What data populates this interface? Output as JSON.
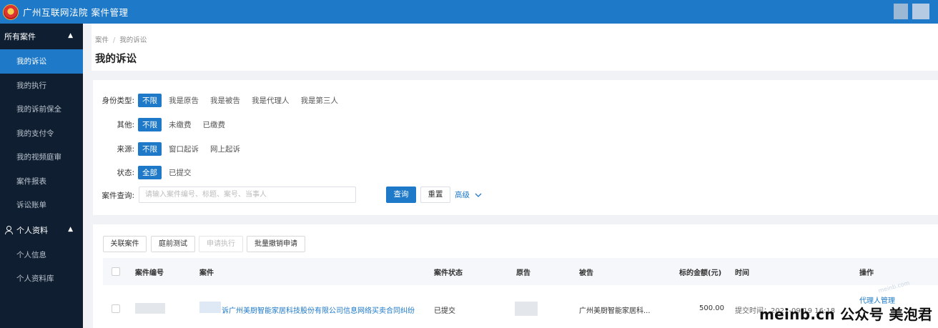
{
  "header": {
    "title": "广州互联网法院 案件管理"
  },
  "sidebar": {
    "groups": [
      {
        "label": "所有案件",
        "items": [
          {
            "label": "我的诉讼",
            "active": true
          },
          {
            "label": "我的执行"
          },
          {
            "label": "我的诉前保全"
          },
          {
            "label": "我的支付令"
          },
          {
            "label": "我的视频庭审"
          },
          {
            "label": "案件报表"
          },
          {
            "label": "诉讼账单"
          }
        ]
      },
      {
        "label": "个人资料",
        "items": [
          {
            "label": "个人信息"
          },
          {
            "label": "个人资料库"
          }
        ]
      }
    ]
  },
  "breadcrumb": {
    "root": "案件",
    "sep": "/",
    "current": "我的诉讼"
  },
  "page_title": "我的诉讼",
  "filters": {
    "identity": {
      "label": "身份类型:",
      "options": [
        "不限",
        "我是原告",
        "我是被告",
        "我是代理人",
        "我是第三人"
      ]
    },
    "other": {
      "label": "其他:",
      "options": [
        "不限",
        "未缴费",
        "已缴费"
      ]
    },
    "source": {
      "label": "来源:",
      "options": [
        "不限",
        "窗口起诉",
        "网上起诉"
      ]
    },
    "status": {
      "label": "状态:",
      "options": [
        "全部",
        "已提交"
      ]
    },
    "query": {
      "label": "案件查询:",
      "placeholder": "请输入案件编号、标题、案号、当事人",
      "search_button": "查询",
      "reset_button": "重置",
      "advanced": "高级"
    }
  },
  "toolbar": {
    "link_case": "关联案件",
    "pretrial_test": "庭前测试",
    "apply_execution": "申请执行",
    "batch_withdraw": "批量撤销申请"
  },
  "table": {
    "columns": [
      "案件编号",
      "案件",
      "案件状态",
      "原告",
      "被告",
      "标的金额(元)",
      "时间",
      "操作"
    ],
    "rows": [
      {
        "case_title": "诉广州美厨智能家居科技股份有限公司信息网络买卖合同纠纷",
        "status": "已提交",
        "defendant": "广州美厨智能家居科...",
        "amount": "500.00",
        "time": "提交时间：2021-09-19 16:18",
        "action": "代理人管理"
      }
    ]
  },
  "watermark": "meinb.cn 公众号 美泡君"
}
